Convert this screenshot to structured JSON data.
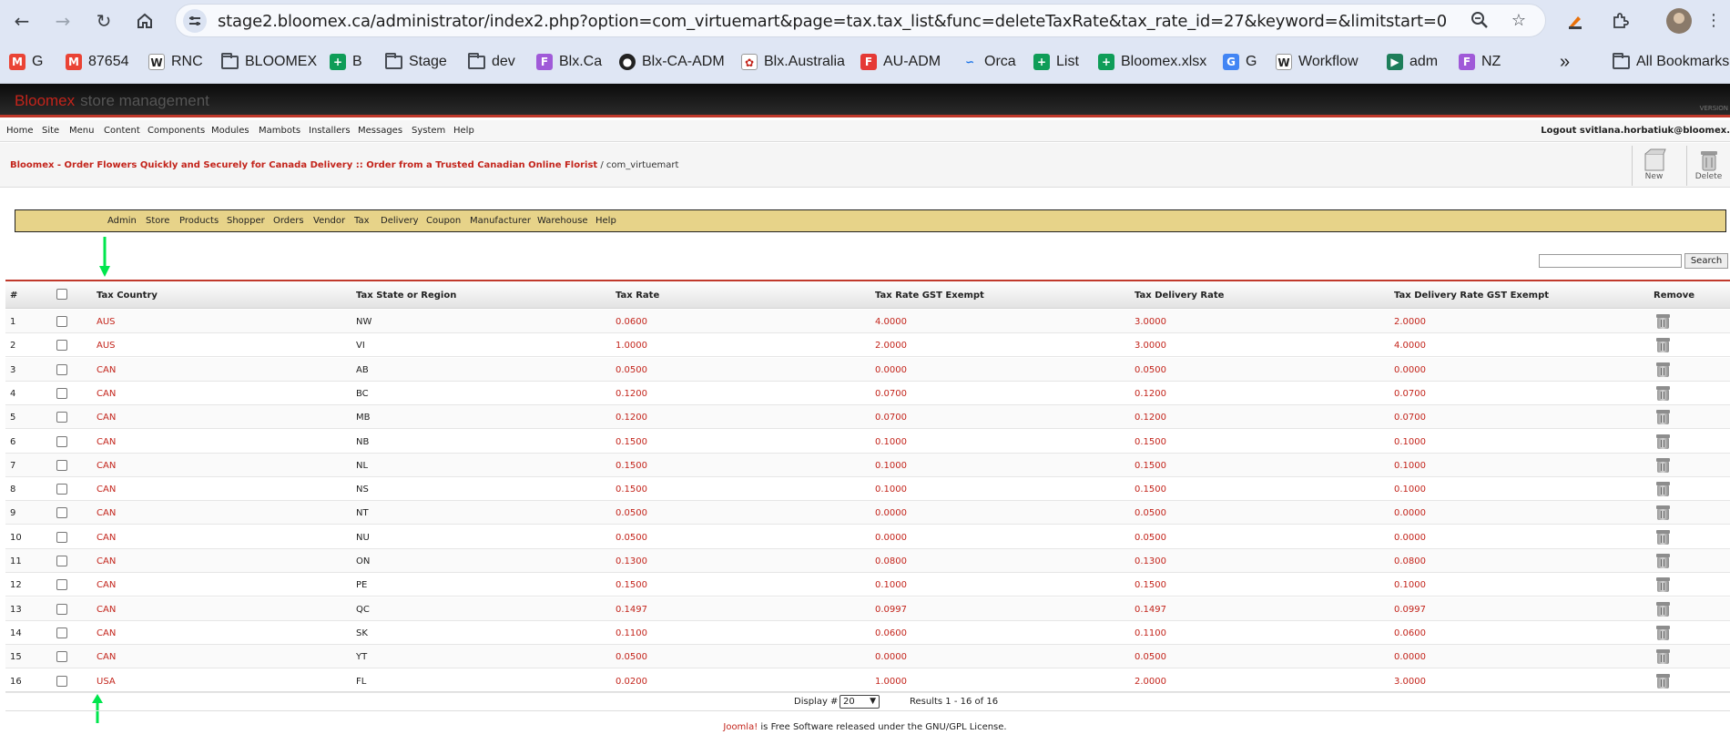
{
  "browser": {
    "url": "stage2.bloomex.ca/administrator/index2.php?option=com_virtuemart&page=tax.tax_list&func=deleteTaxRate&tax_rate_id=27&keyword=&limitstart=0",
    "bookmarks": [
      {
        "label": "G",
        "icon": "gmail-icon",
        "color": "#ea4335"
      },
      {
        "label": "87654",
        "icon": "gmail-icon",
        "color": "#ea4335"
      },
      {
        "label": "RNC",
        "icon": "wiki-icon",
        "color": "#ffffff"
      },
      {
        "label": "BLOOMEX",
        "icon": "folder-icon",
        "color": "#474c54"
      },
      {
        "label": "B",
        "icon": "sheets-icon",
        "color": "#0f9d58"
      },
      {
        "label": "Stage",
        "icon": "folder-icon",
        "color": "#474c54"
      },
      {
        "label": "dev",
        "icon": "folder-icon",
        "color": "#474c54"
      },
      {
        "label": "Blx.Ca",
        "icon": "f3-icon",
        "color": "#a05ad8"
      },
      {
        "label": "Blx-CA-ADM",
        "icon": "globe-icon",
        "color": "#222222"
      },
      {
        "label": "Blx.Australia",
        "icon": "flower-icon",
        "color": "#ffffff"
      },
      {
        "label": "AU-ADM",
        "icon": "f3-icon",
        "color": "#e53935"
      },
      {
        "label": "Orca",
        "icon": "orca-icon",
        "color": "#1a73e8"
      },
      {
        "label": "List",
        "icon": "sheets-icon",
        "color": "#0f9d58"
      },
      {
        "label": "Bloomex.xlsx",
        "icon": "sheets-icon",
        "color": "#0f9d58"
      },
      {
        "label": "G",
        "icon": "google-icon",
        "color": "#4285f4"
      },
      {
        "label": "Workflow",
        "icon": "wiki-icon",
        "color": "#ffffff"
      },
      {
        "label": "adm",
        "icon": "play-icon",
        "color": "#1e7e5a"
      },
      {
        "label": "NZ",
        "icon": "f3-icon",
        "color": "#a05ad8"
      }
    ],
    "overflow_label": "»",
    "all_bookmarks": "All Bookmarks"
  },
  "admin": {
    "brand_name": "Bloomex",
    "brand_suffix": "store management",
    "version_mark": "VERSION",
    "menu": [
      "Home",
      "Site",
      "Menu",
      "Content",
      "Components",
      "Modules",
      "Mambots",
      "Installers",
      "Messages",
      "System",
      "Help"
    ],
    "logout": "Logout svitlana.horbatiuk@bloomex.",
    "pathway_site": "Bloomex - Order Flowers Quickly and Securely for Canada Delivery :: Order from a Trusted Canadian Online Florist",
    "pathway_sep": " / ",
    "pathway_component": "com_virtuemart",
    "toolbar": {
      "new_label": "New",
      "delete_label": "Delete"
    },
    "vm_menu": [
      "Admin",
      "Store",
      "Products",
      "Shopper",
      "Orders",
      "Vendor",
      "Tax",
      "Delivery",
      "Coupon",
      "Manufacturer",
      "Warehouse",
      "Help"
    ],
    "search_value": "",
    "search_button": "Search"
  },
  "table": {
    "columns": [
      "#",
      "Tax Country",
      "Tax State or Region",
      "Tax Rate",
      "Tax Rate GST Exempt",
      "Tax Delivery Rate",
      "Tax Delivery Rate GST Exempt",
      "Remove"
    ],
    "rows": [
      {
        "n": "1",
        "country": "AUS",
        "state": "NW",
        "rate": "0.0600",
        "gst_exempt": "4.0000",
        "delivery": "3.0000",
        "delivery_gst_exempt": "2.0000"
      },
      {
        "n": "2",
        "country": "AUS",
        "state": "VI",
        "rate": "1.0000",
        "gst_exempt": "2.0000",
        "delivery": "3.0000",
        "delivery_gst_exempt": "4.0000"
      },
      {
        "n": "3",
        "country": "CAN",
        "state": "AB",
        "rate": "0.0500",
        "gst_exempt": "0.0000",
        "delivery": "0.0500",
        "delivery_gst_exempt": "0.0000"
      },
      {
        "n": "4",
        "country": "CAN",
        "state": "BC",
        "rate": "0.1200",
        "gst_exempt": "0.0700",
        "delivery": "0.1200",
        "delivery_gst_exempt": "0.0700"
      },
      {
        "n": "5",
        "country": "CAN",
        "state": "MB",
        "rate": "0.1200",
        "gst_exempt": "0.0700",
        "delivery": "0.1200",
        "delivery_gst_exempt": "0.0700"
      },
      {
        "n": "6",
        "country": "CAN",
        "state": "NB",
        "rate": "0.1500",
        "gst_exempt": "0.1000",
        "delivery": "0.1500",
        "delivery_gst_exempt": "0.1000"
      },
      {
        "n": "7",
        "country": "CAN",
        "state": "NL",
        "rate": "0.1500",
        "gst_exempt": "0.1000",
        "delivery": "0.1500",
        "delivery_gst_exempt": "0.1000"
      },
      {
        "n": "8",
        "country": "CAN",
        "state": "NS",
        "rate": "0.1500",
        "gst_exempt": "0.1000",
        "delivery": "0.1500",
        "delivery_gst_exempt": "0.1000"
      },
      {
        "n": "9",
        "country": "CAN",
        "state": "NT",
        "rate": "0.0500",
        "gst_exempt": "0.0000",
        "delivery": "0.0500",
        "delivery_gst_exempt": "0.0000"
      },
      {
        "n": "10",
        "country": "CAN",
        "state": "NU",
        "rate": "0.0500",
        "gst_exempt": "0.0000",
        "delivery": "0.0500",
        "delivery_gst_exempt": "0.0000"
      },
      {
        "n": "11",
        "country": "CAN",
        "state": "ON",
        "rate": "0.1300",
        "gst_exempt": "0.0800",
        "delivery": "0.1300",
        "delivery_gst_exempt": "0.0800"
      },
      {
        "n": "12",
        "country": "CAN",
        "state": "PE",
        "rate": "0.1500",
        "gst_exempt": "0.1000",
        "delivery": "0.1500",
        "delivery_gst_exempt": "0.1000"
      },
      {
        "n": "13",
        "country": "CAN",
        "state": "QC",
        "rate": "0.1497",
        "gst_exempt": "0.0997",
        "delivery": "0.1497",
        "delivery_gst_exempt": "0.0997"
      },
      {
        "n": "14",
        "country": "CAN",
        "state": "SK",
        "rate": "0.1100",
        "gst_exempt": "0.0600",
        "delivery": "0.1100",
        "delivery_gst_exempt": "0.0600"
      },
      {
        "n": "15",
        "country": "CAN",
        "state": "YT",
        "rate": "0.0500",
        "gst_exempt": "0.0000",
        "delivery": "0.0500",
        "delivery_gst_exempt": "0.0000"
      },
      {
        "n": "16",
        "country": "USA",
        "state": "FL",
        "rate": "0.0200",
        "gst_exempt": "1.0000",
        "delivery": "2.0000",
        "delivery_gst_exempt": "3.0000"
      }
    ],
    "display_label": "Display #",
    "display_value": "20",
    "results": "Results 1 - 16 of 16"
  },
  "footer": {
    "joomla": "Joomla!",
    "text": " is Free Software released under the GNU/GPL License."
  },
  "colors": {
    "accent_red": "#c3241b",
    "vm_menu_bg": "#e7d389",
    "annotation_arrow": "#00e64d"
  }
}
